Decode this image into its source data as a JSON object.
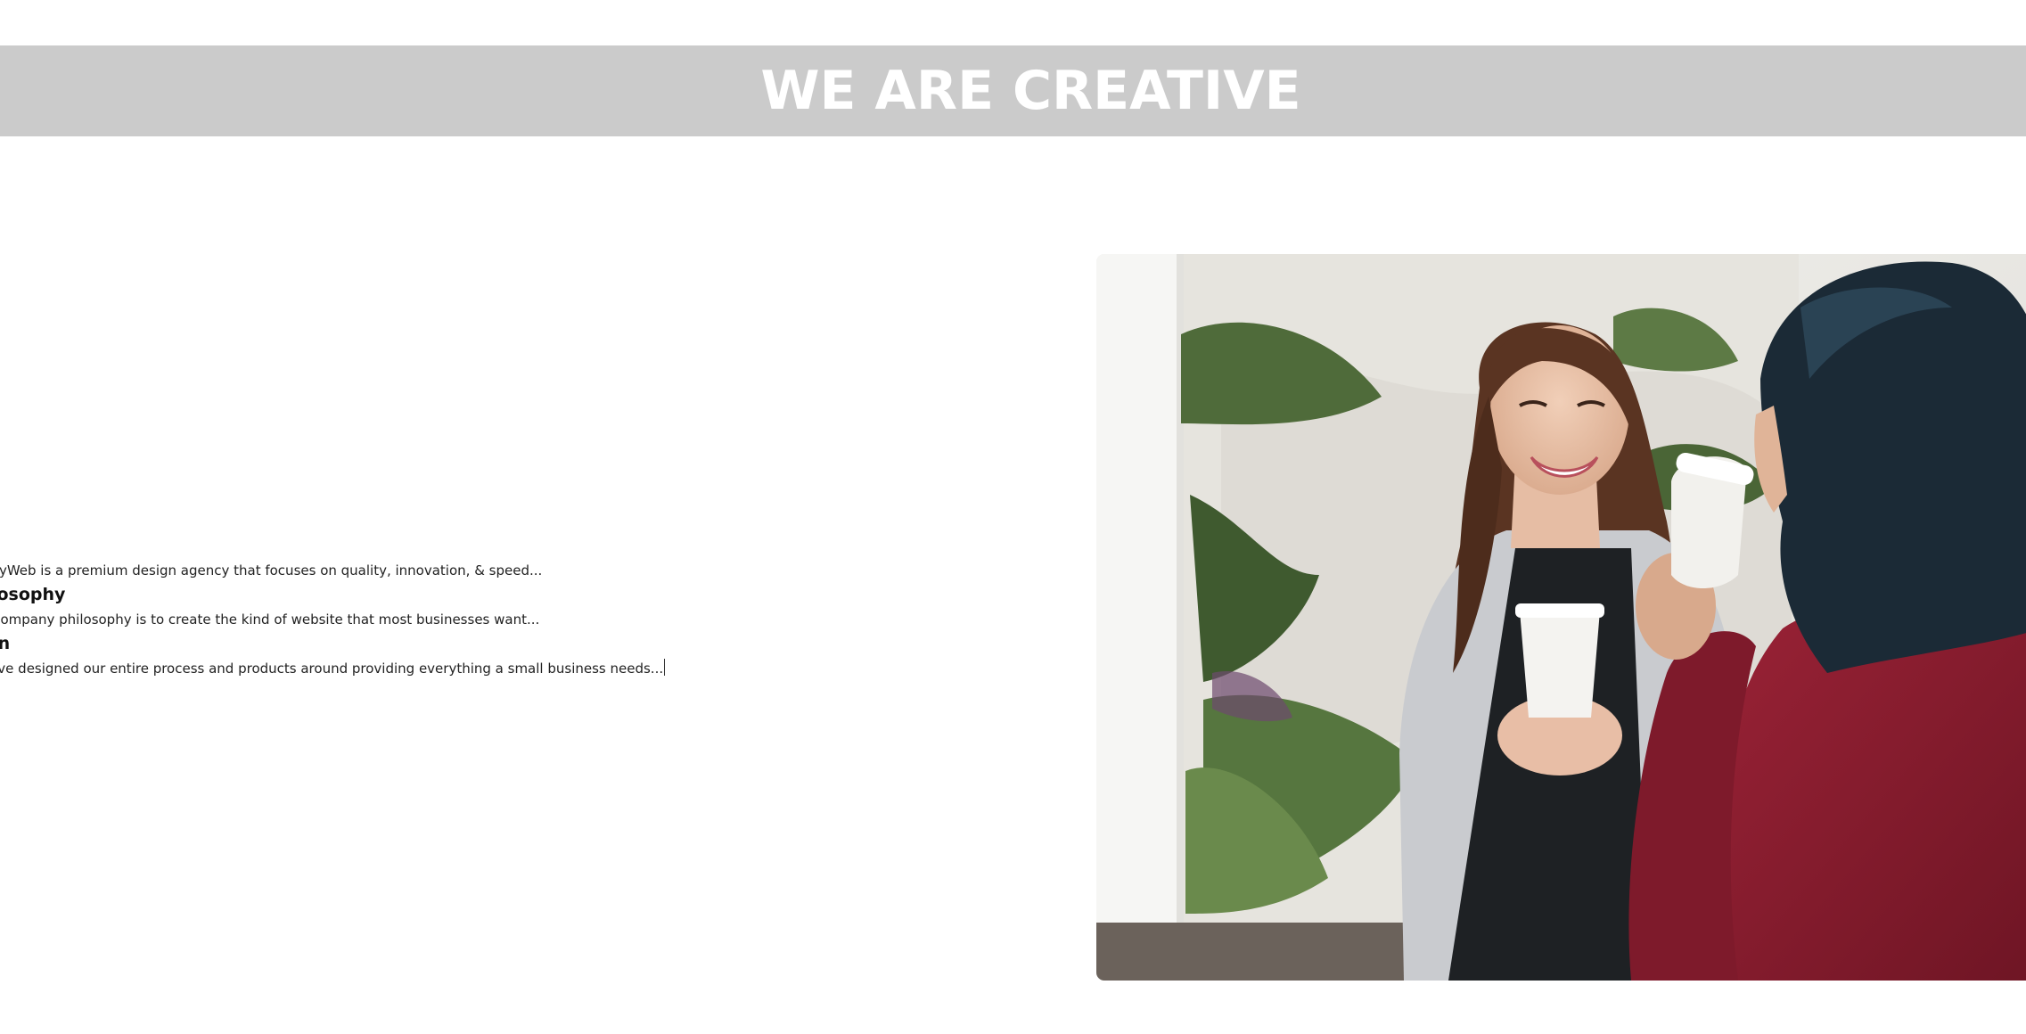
{
  "banner": {
    "title": "WE ARE CREATIVE"
  },
  "about": {
    "intro": "MyWeb is a premium design agency that focuses on quality, innovation, & speed...",
    "philosophy_heading": "Philosophy",
    "philosophy_text": "Our company philosophy is to create the kind of website that most businesses want...",
    "mission_heading": "Mission",
    "mission_text": "We've designed our entire process and products around providing everything a small business needs..."
  },
  "photo": {
    "icon": "photo-two-women-coffee",
    "colors": {
      "wall": "#ecebe6",
      "plants": "#4f6b3a",
      "cardigan": "#c9cbcf",
      "top": "#1e2124",
      "red_blouse": "#8c1c2e",
      "hair_dark": "#1b2a36",
      "hair_brown": "#5a3422",
      "cup": "#f4f3f0"
    }
  }
}
